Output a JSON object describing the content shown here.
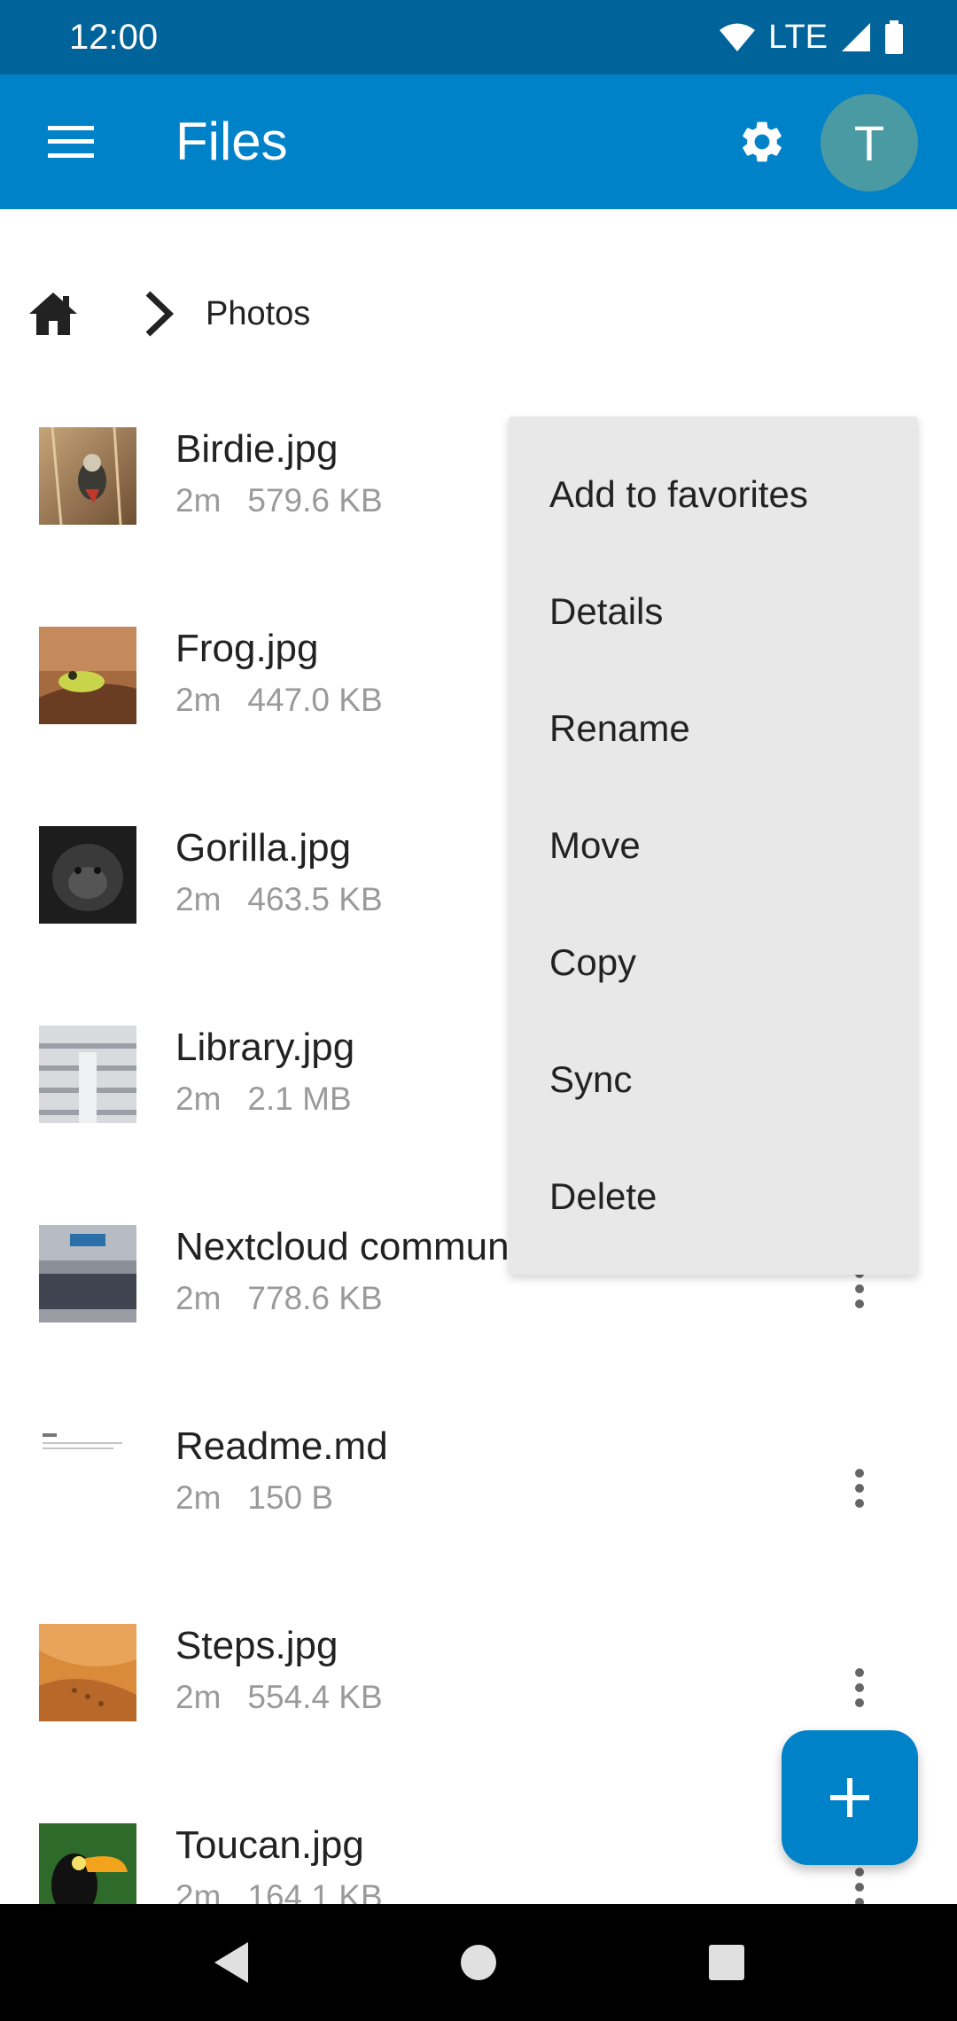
{
  "status_bar": {
    "time": "12:00",
    "network": "LTE"
  },
  "app_bar": {
    "title": "Files",
    "avatar_initial": "T"
  },
  "breadcrumb": {
    "current": "Photos"
  },
  "files": [
    {
      "name": "Birdie.jpg",
      "modified": "2m",
      "size": "579.6 KB",
      "thumb": "bird"
    },
    {
      "name": "Frog.jpg",
      "modified": "2m",
      "size": "447.0 KB",
      "thumb": "frog"
    },
    {
      "name": "Gorilla.jpg",
      "modified": "2m",
      "size": "463.5 KB",
      "thumb": "gorilla"
    },
    {
      "name": "Library.jpg",
      "modified": "2m",
      "size": "2.1 MB",
      "thumb": "library"
    },
    {
      "name": "Nextcloud commun",
      "modified": "2m",
      "size": "778.6 KB",
      "thumb": "community"
    },
    {
      "name": "Readme.md",
      "modified": "2m",
      "size": "150 B",
      "thumb": "document"
    },
    {
      "name": "Steps.jpg",
      "modified": "2m",
      "size": "554.4 KB",
      "thumb": "desert"
    },
    {
      "name": "Toucan.jpg",
      "modified": "2m",
      "size": "164.1 KB",
      "thumb": "toucan"
    }
  ],
  "context_menu": {
    "items": [
      "Add to favorites",
      "Details",
      "Rename",
      "Move",
      "Copy",
      "Sync",
      "Delete"
    ]
  },
  "icons": {
    "menu": "hamburger-icon",
    "settings": "gear-icon",
    "home": "home-icon",
    "chevron": "chevron-right-icon",
    "more": "more-vertical-icon",
    "fab": "plus-icon"
  },
  "colors": {
    "status_bar": "#00639a",
    "app_bar": "#0082c9",
    "avatar": "#4a9aa3",
    "menu_bg": "#e8e8e8",
    "secondary_text": "#9a9a9a"
  }
}
